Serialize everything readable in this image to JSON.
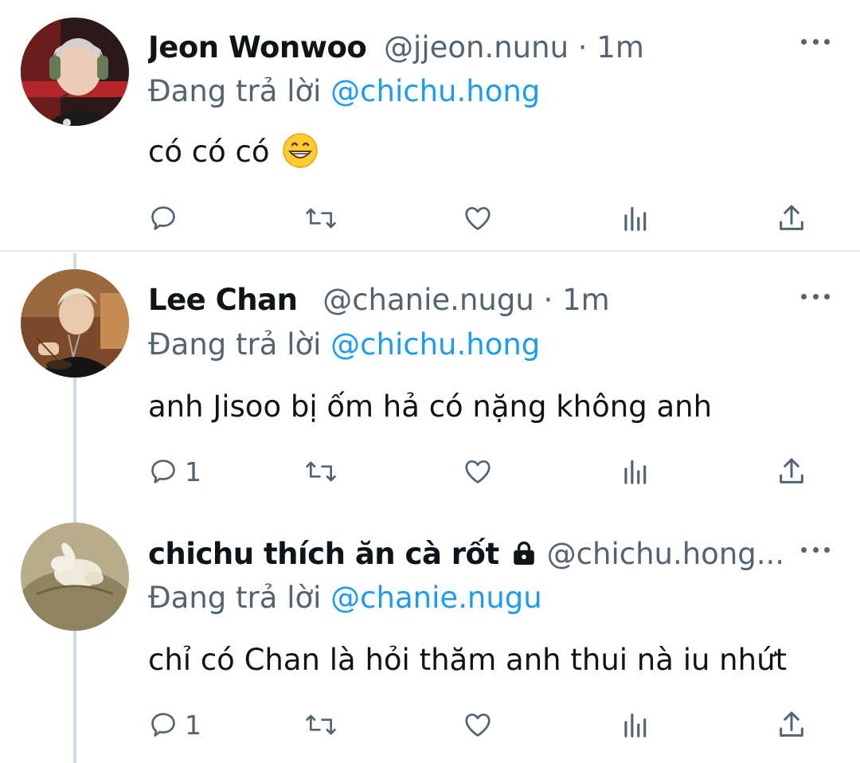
{
  "tweets": [
    {
      "name": "Jeon Wonwoo",
      "handle": "@jjeon.nunu",
      "time": "1m",
      "reply_prefix": "Đang trả lời",
      "reply_to": "@chichu.hong",
      "text": "có có có",
      "emoji": "grinning-face",
      "reply_count": "",
      "locked": false
    },
    {
      "name": "Lee Chan",
      "handle": "@chanie.nugu",
      "time": "1m",
      "reply_prefix": "Đang trả lời",
      "reply_to": "@chichu.hong",
      "text": "anh Jisoo bị ốm hả có nặng không anh",
      "reply_count": "1",
      "locked": false
    },
    {
      "name": "chichu thích ăn cà rốt",
      "handle": "@chichu.hong...",
      "time": "",
      "reply_prefix": "Đang trả lời",
      "reply_to": "@chanie.nugu",
      "text": "chỉ có Chan là hỏi thăm anh thui nà iu nhứt",
      "reply_count": "1",
      "locked": true
    }
  ],
  "colors": {
    "text": "#0f1419",
    "secondary": "#536471",
    "link": "#1d9bf0",
    "divider": "#e7e7e7",
    "thread_line": "#cfd9de"
  },
  "icons": [
    "reply-icon",
    "retweet-icon",
    "like-icon",
    "views-icon",
    "share-icon",
    "more-icon",
    "lock-icon"
  ]
}
